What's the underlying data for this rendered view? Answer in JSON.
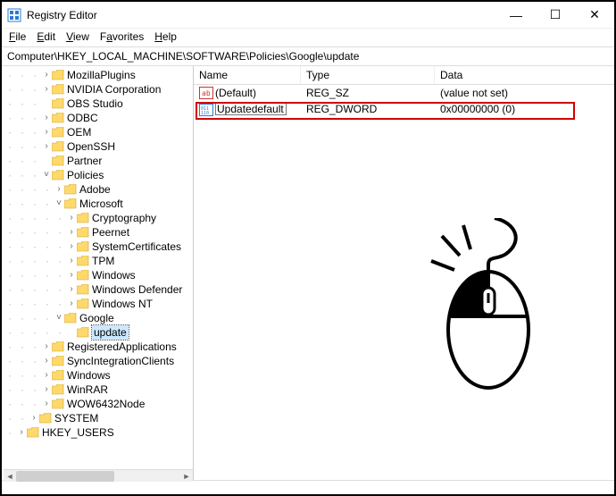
{
  "window": {
    "title": "Registry Editor"
  },
  "menu": {
    "file": "File",
    "edit": "Edit",
    "view": "View",
    "favorites": "Favorites",
    "help": "Help"
  },
  "address": "Computer\\HKEY_LOCAL_MACHINE\\SOFTWARE\\Policies\\Google\\update",
  "columns": {
    "name": "Name",
    "type": "Type",
    "data": "Data"
  },
  "values": [
    {
      "icon": "string",
      "name": "(Default)",
      "type": "REG_SZ",
      "data": "(value not set)"
    },
    {
      "icon": "dword",
      "name": "Updatedefault",
      "type": "REG_DWORD",
      "data": "0x00000000 (0)",
      "editing": true
    }
  ],
  "tree": [
    {
      "indent": 3,
      "expander": ">",
      "label": "MozillaPlugins"
    },
    {
      "indent": 3,
      "expander": ">",
      "label": "NVIDIA Corporation"
    },
    {
      "indent": 3,
      "expander": "",
      "label": "OBS Studio"
    },
    {
      "indent": 3,
      "expander": ">",
      "label": "ODBC"
    },
    {
      "indent": 3,
      "expander": ">",
      "label": "OEM"
    },
    {
      "indent": 3,
      "expander": ">",
      "label": "OpenSSH"
    },
    {
      "indent": 3,
      "expander": "",
      "label": "Partner"
    },
    {
      "indent": 3,
      "expander": "v",
      "label": "Policies"
    },
    {
      "indent": 4,
      "expander": ">",
      "label": "Adobe"
    },
    {
      "indent": 4,
      "expander": "v",
      "label": "Microsoft"
    },
    {
      "indent": 5,
      "expander": ">",
      "label": "Cryptography"
    },
    {
      "indent": 5,
      "expander": ">",
      "label": "Peernet"
    },
    {
      "indent": 5,
      "expander": ">",
      "label": "SystemCertificates"
    },
    {
      "indent": 5,
      "expander": ">",
      "label": "TPM"
    },
    {
      "indent": 5,
      "expander": ">",
      "label": "Windows"
    },
    {
      "indent": 5,
      "expander": ">",
      "label": "Windows Defender"
    },
    {
      "indent": 5,
      "expander": ">",
      "label": "Windows NT"
    },
    {
      "indent": 4,
      "expander": "v",
      "label": "Google"
    },
    {
      "indent": 5,
      "expander": "",
      "label": "update",
      "selected": true
    },
    {
      "indent": 3,
      "expander": ">",
      "label": "RegisteredApplications"
    },
    {
      "indent": 3,
      "expander": ">",
      "label": "SyncIntegrationClients"
    },
    {
      "indent": 3,
      "expander": ">",
      "label": "Windows"
    },
    {
      "indent": 3,
      "expander": ">",
      "label": "WinRAR"
    },
    {
      "indent": 3,
      "expander": ">",
      "label": "WOW6432Node"
    },
    {
      "indent": 2,
      "expander": ">",
      "label": "SYSTEM"
    },
    {
      "indent": 1,
      "expander": ">",
      "label": "HKEY_USERS"
    }
  ]
}
